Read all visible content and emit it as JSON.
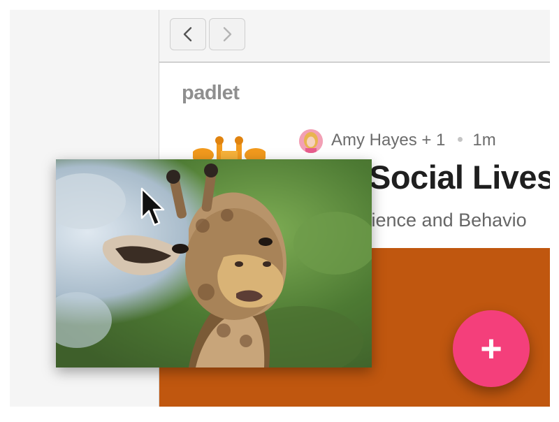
{
  "toolbar": {
    "back_icon": "chevron-left-icon",
    "forward_icon": "chevron-right-icon"
  },
  "padlet": {
    "brand": "padlet",
    "author": "Amy Hayes + 1",
    "time": "1m",
    "title": "Social Lives",
    "subtitle": "cience and Behavio",
    "wall_color": "#c0570f"
  },
  "fab": {
    "label": "+",
    "color": "#f43f7b"
  },
  "drag_image": {
    "subject": "giraffe photo"
  }
}
